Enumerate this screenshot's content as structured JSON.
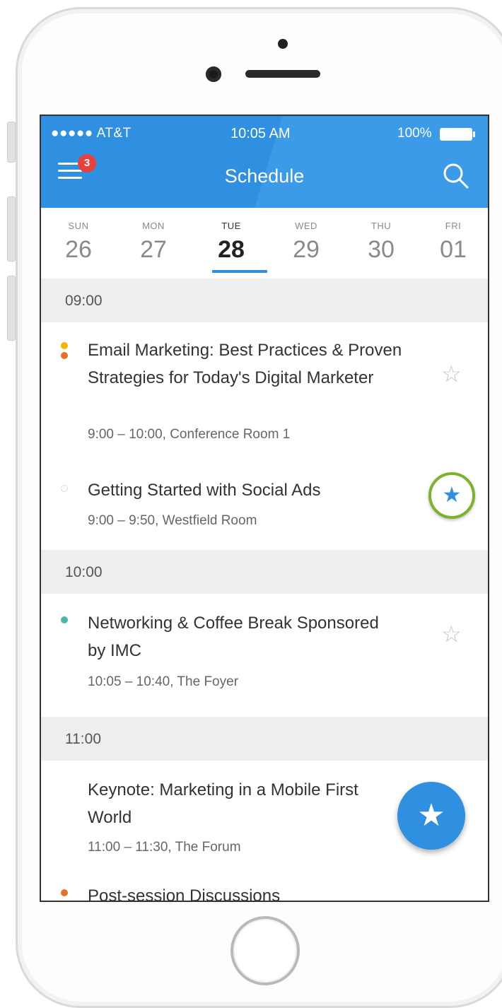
{
  "status_bar": {
    "carrier": "●●●●● AT&T",
    "time": "10:05 AM",
    "battery": "100%"
  },
  "header": {
    "title": "Schedule",
    "menu_badge": "3"
  },
  "days": [
    {
      "name": "SUN",
      "number": "26"
    },
    {
      "name": "MON",
      "number": "27"
    },
    {
      "name": "TUE",
      "number": "28"
    },
    {
      "name": "WED",
      "number": "29"
    },
    {
      "name": "THU",
      "number": "30"
    },
    {
      "name": "FRI",
      "number": "01"
    }
  ],
  "selected_day": "28",
  "sections": [
    {
      "time": "09:00"
    },
    {
      "time": "10:00"
    },
    {
      "time": "11:00"
    }
  ],
  "events": [
    {
      "title": "Email Marketing: Best Practices & Proven Strategies for Today's Digital Marketer",
      "meta": "9:00 – 10:00,  Conference Room 1",
      "dot_color": "#f0a22e",
      "starred": false
    },
    {
      "title": "Getting Started with Social Ads",
      "meta": "9:00 – 9:50,  Westfield Room",
      "dot_color": "#dddddd",
      "starred": true
    },
    {
      "title": "Networking & Coffee Break Sponsored by IMC",
      "meta": "10:05 – 10:40,  The Foyer",
      "dot_color": "#4db6ac",
      "starred": false
    },
    {
      "title": "Keynote: Marketing in a Mobile First World",
      "meta": "11:00 – 11:30,  The Forum",
      "dot_color": "",
      "starred": false
    },
    {
      "title": "Post-session Discussions",
      "meta": "",
      "dot_color": "#e8702a",
      "starred": false
    }
  ],
  "colors": {
    "accent": "#2f8fe0",
    "highlight_ring": "#7cb22c",
    "badge": "#e8413c"
  },
  "icons": {
    "menu": "hamburger-menu-icon",
    "search": "search-icon",
    "star": "star-icon",
    "fab": "star-filled-icon"
  }
}
